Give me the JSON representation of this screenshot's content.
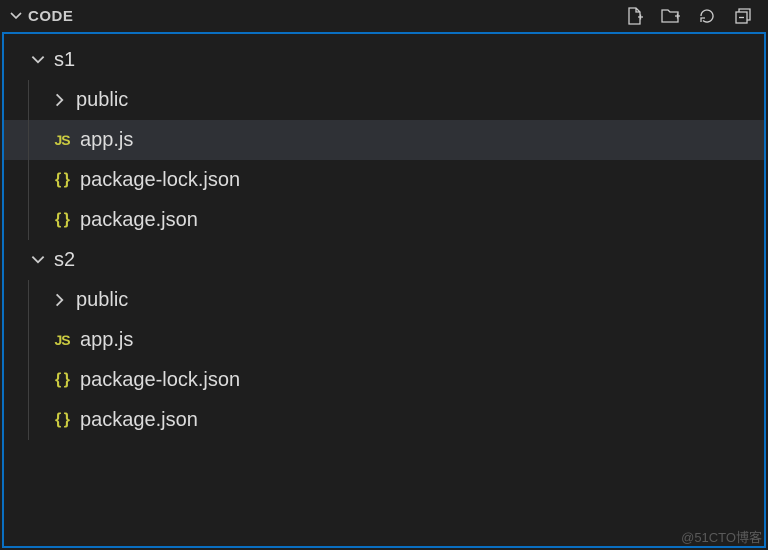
{
  "header": {
    "title": "CODE",
    "actions": {
      "new_file": "New File",
      "new_folder": "New Folder",
      "refresh": "Refresh",
      "collapse": "Collapse All"
    }
  },
  "tree": {
    "s1": {
      "name": "s1",
      "public": "public",
      "app_js": "app.js",
      "pkg_lock": "package-lock.json",
      "pkg": "package.json"
    },
    "s2": {
      "name": "s2",
      "public": "public",
      "app_js": "app.js",
      "pkg_lock": "package-lock.json",
      "pkg": "package.json"
    }
  },
  "icons": {
    "js": "JS",
    "json": "{ }"
  },
  "selected": "tree.s1.app_js",
  "watermark": "@51CTO博客"
}
